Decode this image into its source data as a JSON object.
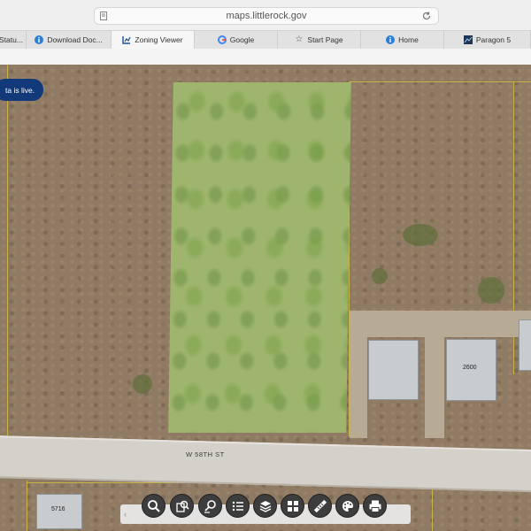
{
  "browser": {
    "url": "maps.littlerock.gov",
    "tabs": [
      {
        "label": "Statu...",
        "icon": "globe-icon"
      },
      {
        "label": "Download Doc...",
        "icon": "info-icon"
      },
      {
        "label": "Zoning Viewer",
        "icon": "zoning-viewer-icon",
        "active": true
      },
      {
        "label": "Google",
        "icon": "google-icon"
      },
      {
        "label": "Start Page",
        "icon": "star-icon"
      },
      {
        "label": "Home",
        "icon": "info-icon"
      },
      {
        "label": "Paragon 5",
        "icon": "paragon-icon"
      }
    ]
  },
  "map": {
    "live_badge": "ta is live.",
    "street_label": "W 58TH ST",
    "buildings": [
      "2600",
      "5716"
    ]
  },
  "toolbar": {
    "tools": [
      "search-icon",
      "identify-icon",
      "search-area-icon",
      "layer-list-icon",
      "layers-icon",
      "basemap-gallery-icon",
      "measure-icon",
      "paint-icon",
      "print-icon"
    ]
  },
  "colors": {
    "live_badge_bg": "#123a7a",
    "parcel_lines": "#c9b24a",
    "grass_highlight": "#9fb56d",
    "toolbar_button": "#3d3d3d"
  }
}
